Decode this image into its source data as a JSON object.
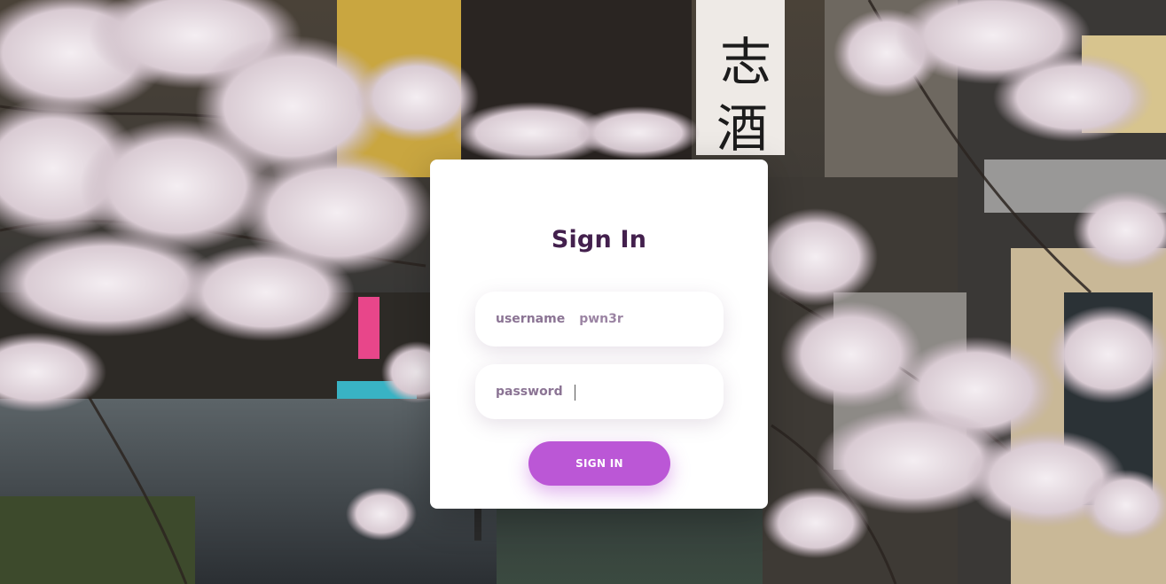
{
  "form": {
    "title": "Sign In",
    "username": {
      "label": "username",
      "value": "pwn3r"
    },
    "password": {
      "label": "password",
      "value": ""
    },
    "submit_label": "SIGN IN"
  },
  "colors": {
    "title": "#43204d",
    "label": "#8b7494",
    "button": "#bb57d6",
    "card": "#ffffff"
  }
}
